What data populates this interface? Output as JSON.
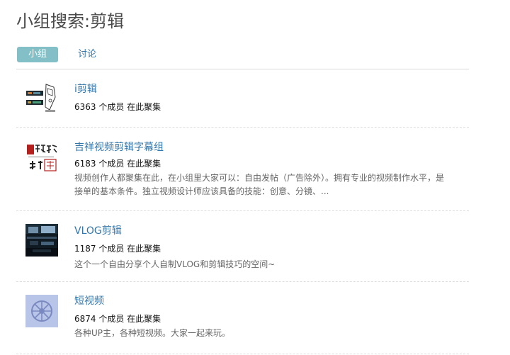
{
  "page": {
    "title": "小组搜索:剪辑"
  },
  "tabs": [
    {
      "label": "小组",
      "active": true
    },
    {
      "label": "讨论",
      "active": false
    }
  ],
  "colors": {
    "accent_tab": "#83bfc6",
    "link": "#3377aa",
    "description": "#666666"
  },
  "groups": [
    {
      "name": "i剪辑",
      "members": "6363 个成员 在此聚集",
      "description_lines": [],
      "thumb_icon": "phone-sketch-icon"
    },
    {
      "name": "吉祥视频剪辑字幕组",
      "members": "6183 个成员 在此聚集",
      "description_lines": [
        "视频创作人都聚集在此，在小组里大家可以：自由发帖（广告除外）。拥有专业的视频制作水平，是",
        "接单的基本条件。独立视频设计师应该具备的技能：创意、分镜、..."
      ],
      "thumb_icon": "calligraphy-logo-icon"
    },
    {
      "name": "VLOG剪辑",
      "members": "1187 个成员 在此聚集",
      "description_lines": [
        "这个一个自由分享个人自制VLOG和剪辑技巧的空间~"
      ],
      "thumb_icon": "editing-desk-icon"
    },
    {
      "name": "短视频",
      "members": "6874 个成员 在此聚集",
      "description_lines": [
        "各种UP主，各种短视频。大家一起来玩。"
      ],
      "thumb_icon": "film-reel-icon"
    }
  ]
}
